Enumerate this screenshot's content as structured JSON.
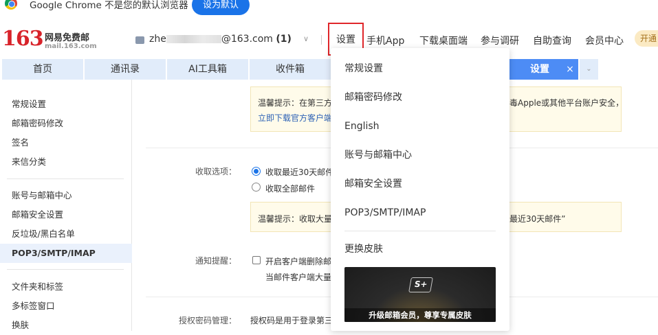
{
  "banner": {
    "text": "Google Chrome 不是您的默认浏览器",
    "button": "设为默认"
  },
  "header": {
    "logo_number": "163",
    "logo_name": "网易免费邮",
    "logo_domain": "mail.163.com",
    "account_prefix": "zhe",
    "account_suffix": "@163.com",
    "account_count": "(1)",
    "nav": [
      "设置",
      "手机App",
      "下载桌面端",
      "参与调研",
      "自助查询",
      "会员中心"
    ],
    "vip_label": "开通"
  },
  "tabs": {
    "items": [
      "首页",
      "通讯录",
      "AI工具箱",
      "收件箱"
    ],
    "active": "设置",
    "close_glyph": "×",
    "more_glyph": "⌄"
  },
  "sidebar": {
    "group1": [
      "常规设置",
      "邮箱密码修改",
      "签名",
      "来信分类"
    ],
    "group2": [
      "账号与邮箱中心",
      "邮箱安全设置",
      "反垃圾/黑白名单",
      "POP3/SMTP/IMAP"
    ],
    "group3": [
      "文件夹和标签",
      "多标签窗口",
      "换肤"
    ],
    "active": "POP3/SMTP/IMAP"
  },
  "content": {
    "tip1_line1_a": "温馨提示：在第三方",
    "tip1_line1_b": "毒Apple或其他平台账户安全，",
    "tip1_line2": "立即下载官方客户端",
    "receive_label": "收取选项：",
    "receive_opt1": "收取最近30天邮件",
    "receive_opt2": "收取全部邮件",
    "tip2_a": "温馨提示：收取大量",
    "tip2_b": "最近30天邮件”",
    "notify_label": "通知提醒：",
    "notify_opt": "开启客户端删除邮",
    "notify_sub": "当邮件客户端大量",
    "auth_label": "授权密码管理：",
    "auth_text": "授权码是用于登录第三"
  },
  "dropdown": {
    "items": [
      "常规设置",
      "邮箱密码修改",
      "English",
      "账号与邮箱中心",
      "邮箱安全设置",
      "POP3/SMTP/IMAP",
      "更换皮肤"
    ],
    "promo_logo": "S+",
    "promo_text": "升级邮箱会员，尊享专属皮肤"
  },
  "colors": {
    "brand_red": "#d8232a",
    "tab_active": "#4d8cf5",
    "tab_bg": "#e1ecfa",
    "chrome_button": "#1a73e8",
    "highlight_border": "#e0262a"
  }
}
